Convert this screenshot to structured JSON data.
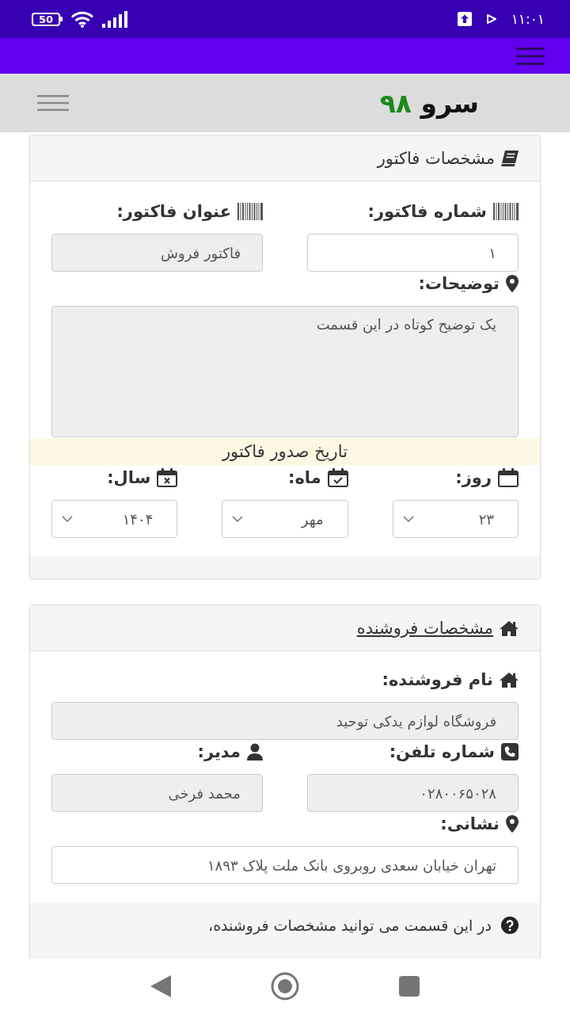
{
  "status_bar": {
    "battery": "50",
    "time": "۱۱:۰۱"
  },
  "header": {
    "logo": {
      "name": "سرو",
      "number": "۹۸"
    }
  },
  "invoice": {
    "title": "مشخصات فاکتور",
    "number": {
      "label": "شماره فاکتور:",
      "value": "۱",
      "readonly": false
    },
    "subject": {
      "label": "عنوان فاکتور:",
      "value": "فاکتور فروش",
      "readonly": true
    },
    "description": {
      "label": "توضیحات:",
      "value": "یک توضیح کوتاه در این قسمت",
      "readonly": true
    },
    "date": {
      "title": "تاریخ صدور فاکتور",
      "selects": [
        {
          "label": "روز:",
          "value": "۲۳"
        },
        {
          "label": "ماه:",
          "value": "مهر"
        },
        {
          "label": "سال:",
          "value": "۱۴۰۴"
        }
      ]
    }
  },
  "seller": {
    "title": "مشخصات فروشنده",
    "name": {
      "label": "نام فروشنده:",
      "value": "فروشگاه لوازم یدکی توحید",
      "readonly": true
    },
    "phone": {
      "label": "شماره تلفن:",
      "value": "۰۲۸۰۰۶۵۰۲۸",
      "readonly": true
    },
    "manager": {
      "label": "مدیر:",
      "value": "محمد فرخی",
      "readonly": true
    },
    "address": {
      "label": "نشانی:",
      "value": "تهران خیابان سعدی روبروی بانک ملت پلاک ۱۸۹۳",
      "readonly": false
    },
    "help": "در این قسمت می توانید مشخصات فروشنده،"
  }
}
